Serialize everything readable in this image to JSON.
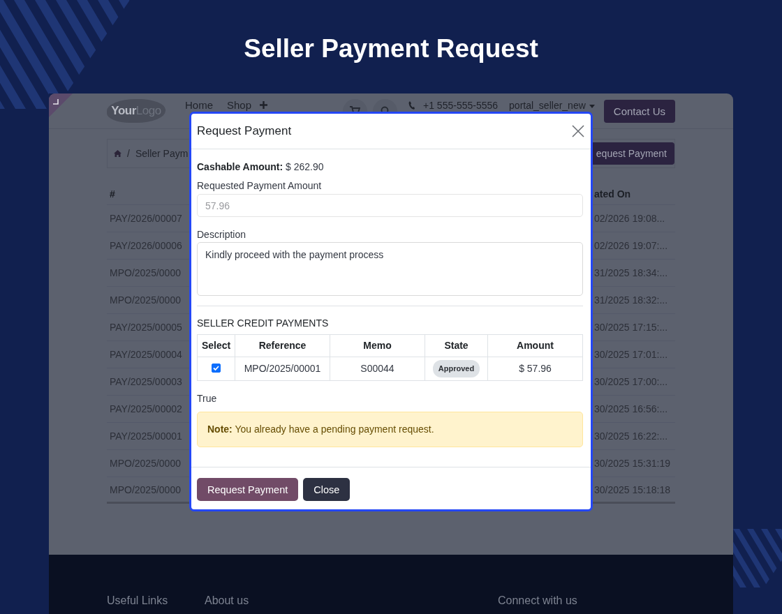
{
  "title": "Seller Payment Request",
  "page": {
    "header": {
      "logo": "**Your**Logo",
      "nav": [
        "Home",
        "Shop"
      ],
      "phone": "+1 555-555-5556",
      "user": "portal_seller_new",
      "contact_button": "Contact Us"
    },
    "breadcrumb": {
      "separator": "/",
      "current": "Seller Paym",
      "button": "equest Payment"
    },
    "table": {
      "columns": [
        "#",
        "ated On"
      ],
      "rows": [
        [
          "PAY/2026/00007",
          "02/2026 19:08..."
        ],
        [
          "PAY/2026/00006",
          "02/2026 19:07:..."
        ],
        [
          "MPO/2025/0000",
          "31/2025 18:34:..."
        ],
        [
          "MPO/2025/0000",
          "31/2025 18:32:..."
        ],
        [
          "PAY/2025/00005",
          "30/2025 17:15:..."
        ],
        [
          "PAY/2025/00004",
          "30/2025 17:01:..."
        ],
        [
          "PAY/2025/00003",
          "30/2025 17:00:..."
        ],
        [
          "PAY/2025/00002",
          "30/2025 16:56:..."
        ],
        [
          "PAY/2025/00001",
          "30/2025 16:22:..."
        ],
        [
          "MPO/2025/0000",
          "30/2025 15:31:19"
        ],
        [
          "MPO/2025/0000",
          "30/2025 15:18:18"
        ]
      ]
    },
    "footer": {
      "links": [
        "Useful Links",
        "About us",
        "Connect with us"
      ]
    }
  },
  "modal": {
    "title": "Request Payment",
    "cashable": "**Cashable Amount:** $ 262.90",
    "amount_field": {
      "label": "Requested Payment Amount",
      "placeholder": "57.96"
    },
    "description_field": {
      "label": "Description",
      "value": "Kindly proceed with the payment process"
    },
    "section_title": "SELLER CREDIT PAYMENTS",
    "credit_table": {
      "columns": [
        "Select",
        "Reference",
        "Memo",
        "State",
        "Amount"
      ],
      "rows": [
        {
          "checked": true,
          "reference": "MPO/2025/00001",
          "memo": "S00044",
          "state": "Approved",
          "amount": "$ 57.96"
        }
      ]
    },
    "flag_text": "True",
    "note": "**Note:** You already have a pending payment request.",
    "buttons": [
      {
        "label": "Request Payment",
        "kind": "primary"
      },
      {
        "label": "Close",
        "kind": "secondary"
      }
    ]
  }
}
